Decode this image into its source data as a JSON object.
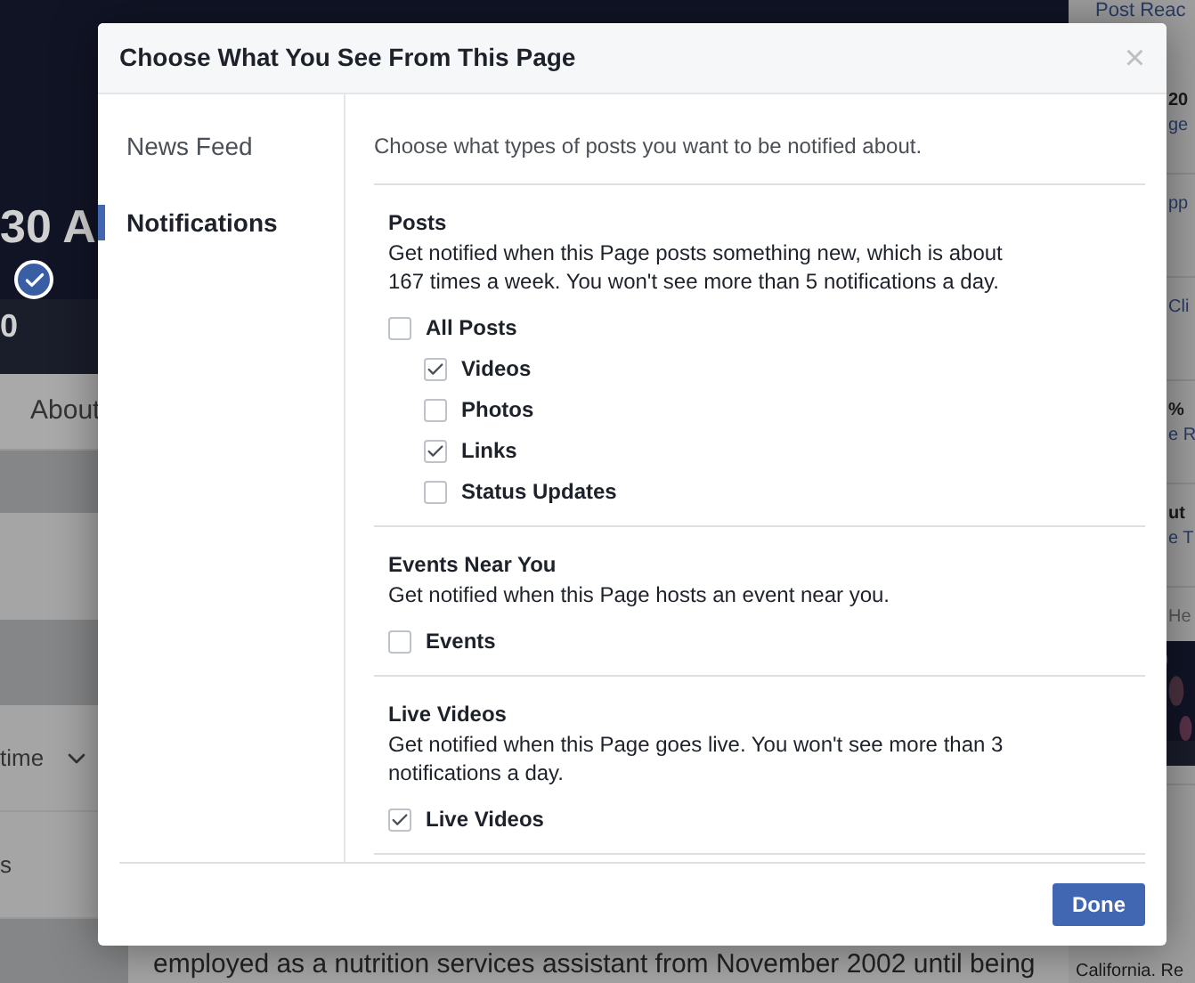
{
  "page": {
    "cover_name": "30 A",
    "cover_subline": "0",
    "tab": "About",
    "left_items": [
      {
        "label": "time",
        "kind": "dropdown"
      },
      {
        "label": "s",
        "kind": "plain"
      }
    ],
    "story_lines": [
      "employed as a nutrition services assistant from November 2002 until being"
    ],
    "sidebar_header": "Post Reac",
    "sidebar": [
      {
        "items": [
          {
            "text": "20",
            "kind": "bold"
          },
          {
            "text": "ge",
            "kind": "link"
          }
        ]
      },
      {
        "items": [
          {
            "text": "pp",
            "kind": "link"
          }
        ]
      },
      {
        "items": [
          {
            "text": "Cli",
            "kind": "link"
          }
        ]
      },
      {
        "items": [
          {
            "text": "%",
            "kind": "bold"
          },
          {
            "text": "e R",
            "kind": "link"
          }
        ]
      },
      {
        "items": [
          {
            "text": "ut",
            "kind": "bold"
          },
          {
            "text": "e T",
            "kind": "link"
          }
        ]
      },
      {
        "items": [
          {
            "text": "He",
            "kind": "muted"
          },
          {
            "kind": "picture"
          }
        ]
      }
    ],
    "sidebar_footer": "California. Re"
  },
  "dialog": {
    "title": "Choose What You See From This Page",
    "close": "×",
    "nav": [
      {
        "label": "News Feed",
        "selected": false
      },
      {
        "label": "Notifications",
        "selected": true
      }
    ],
    "intro": "Choose what types of posts you want to be notified about.",
    "sections": [
      {
        "title": "Posts",
        "description": "Get notified when this Page posts something new, which is about 167 times a week. You won't see more than 5 notifications a day.",
        "options": [
          {
            "label": "All Posts",
            "checked": false,
            "children": [
              {
                "label": "Videos",
                "checked": true
              },
              {
                "label": "Photos",
                "checked": false
              },
              {
                "label": "Links",
                "checked": true
              },
              {
                "label": "Status Updates",
                "checked": false
              }
            ]
          }
        ]
      },
      {
        "title": "Events Near You",
        "description": "Get notified when this Page hosts an event near you.",
        "options": [
          {
            "label": "Events",
            "checked": false
          }
        ]
      },
      {
        "title": "Live Videos",
        "description": "Get notified when this Page goes live. You won't see more than 3 notifications a day.",
        "options": [
          {
            "label": "Live Videos",
            "checked": true
          }
        ]
      }
    ],
    "done_button": "Done"
  }
}
